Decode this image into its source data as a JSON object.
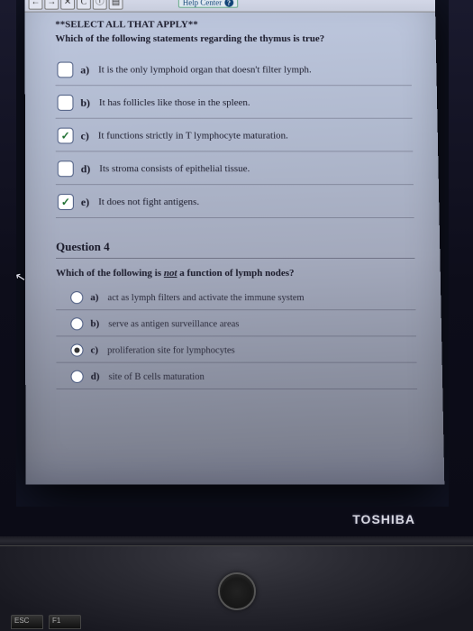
{
  "toolbar": {
    "help_label": "Help Center"
  },
  "q3": {
    "instruction": "**SELECT ALL THAT APPLY**",
    "prompt": "Which of the following statements regarding the thymus is true?",
    "options": [
      {
        "letter": "a)",
        "text": "It is the only lymphoid organ that doesn't filter lymph.",
        "checked": false
      },
      {
        "letter": "b)",
        "text": "It has follicles like those in the spleen.",
        "checked": false
      },
      {
        "letter": "c)",
        "text": "It functions strictly in T lymphocyte maturation.",
        "checked": true
      },
      {
        "letter": "d)",
        "text": "Its stroma consists of epithelial tissue.",
        "checked": false
      },
      {
        "letter": "e)",
        "text": "It does not fight antigens.",
        "checked": true
      }
    ]
  },
  "q4": {
    "heading": "Question 4",
    "prompt_pre": "Which of the following is ",
    "prompt_not": "not",
    "prompt_post": " a function of lymph nodes?",
    "options": [
      {
        "letter": "a)",
        "text": "act as lymph filters and activate the immune system",
        "selected": false
      },
      {
        "letter": "b)",
        "text": "serve as antigen surveillance areas",
        "selected": false
      },
      {
        "letter": "c)",
        "text": "proliferation site for lymphocytes",
        "selected": true
      },
      {
        "letter": "d)",
        "text": "site of B cells maturation",
        "selected": false
      }
    ]
  },
  "brand": "TOSHIBA",
  "keys": [
    "ESC",
    "F1"
  ]
}
